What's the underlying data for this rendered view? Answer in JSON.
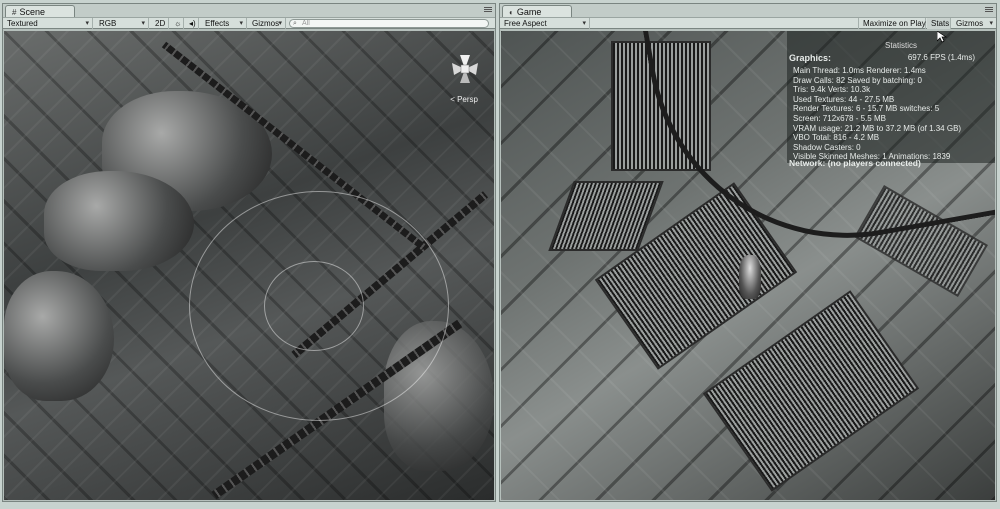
{
  "scene": {
    "tab_label": "Scene",
    "toolbar": {
      "draw_mode": "Textured",
      "render_mode": "RGB",
      "toggle_2d": "2D",
      "effects": "Effects",
      "gizmos": "Gizmos",
      "search_placeholder": "All"
    },
    "view": {
      "projection_label": "< Persp"
    }
  },
  "game": {
    "tab_label": "Game",
    "toolbar": {
      "aspect": "Free Aspect",
      "maximize_on_play": "Maximize on Play",
      "stats": "Stats",
      "gizmos": "Gizmos"
    },
    "stats_overlay": {
      "title": "Statistics",
      "graphics_label": "Graphics:",
      "fps": "697.6 FPS (1.4ms)",
      "lines": [
        "Main Thread: 1.0ms   Renderer: 1.4ms",
        "Draw Calls: 82     Saved by batching: 0",
        "Tris: 9.4k      Verts: 10.3k",
        "Used Textures: 44 - 27.5 MB",
        "Render Textures: 6 - 15.7 MB    switches: 5",
        "Screen: 712x678 - 5.5 MB",
        "VRAM usage: 21.2 MB to 37.2 MB (of 1.34 GB)",
        "VBO Total: 816 - 4.2 MB",
        "Shadow Casters: 0",
        "Visible Skinned Meshes: 1    Animations: 1839"
      ],
      "network": "Network: (no players connected)"
    }
  }
}
